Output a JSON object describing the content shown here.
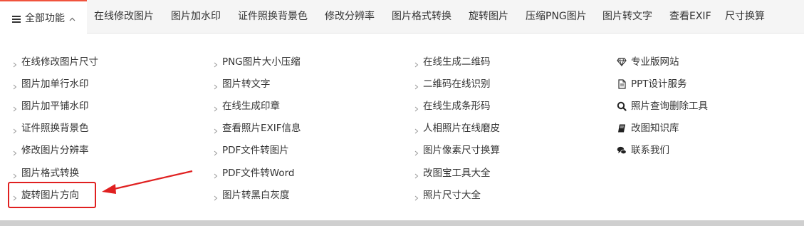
{
  "nav": {
    "all_label": "全部功能",
    "links": [
      "在线修改图片",
      "图片加水印",
      "证件照换背景色",
      "修改分辨率",
      "图片格式转换",
      "旋转图片",
      "压缩PNG图片",
      "图片转文字",
      "查看EXIF",
      "尺寸换算"
    ]
  },
  "dropdown": {
    "col1": [
      "在线修改图片尺寸",
      "图片加单行水印",
      "图片加平铺水印",
      "证件照换背景色",
      "修改图片分辨率",
      "图片格式转换",
      "旋转图片方向"
    ],
    "col2": [
      "PNG图片大小压缩",
      "图片转文字",
      "在线生成印章",
      "查看照片EXIF信息",
      "PDF文件转图片",
      "PDF文件转Word",
      "图片转黑白灰度"
    ],
    "col3": [
      "在线生成二维码",
      "二维码在线识别",
      "在线生成条形码",
      "人相照片在线磨皮",
      "图片像素尺寸换算",
      "改图宝工具大全",
      "照片尺寸大全"
    ],
    "col4": [
      {
        "label": "专业版网站",
        "icon": "diamond-icon"
      },
      {
        "label": "PPT设计服务",
        "icon": "document-icon"
      },
      {
        "label": "照片查询删除工具",
        "icon": "search-icon"
      },
      {
        "label": "改图知识库",
        "icon": "book-icon"
      },
      {
        "label": "联系我们",
        "icon": "chat-icon"
      }
    ]
  },
  "colors": {
    "accent": "#f0533d",
    "annotation": "#e02020"
  }
}
